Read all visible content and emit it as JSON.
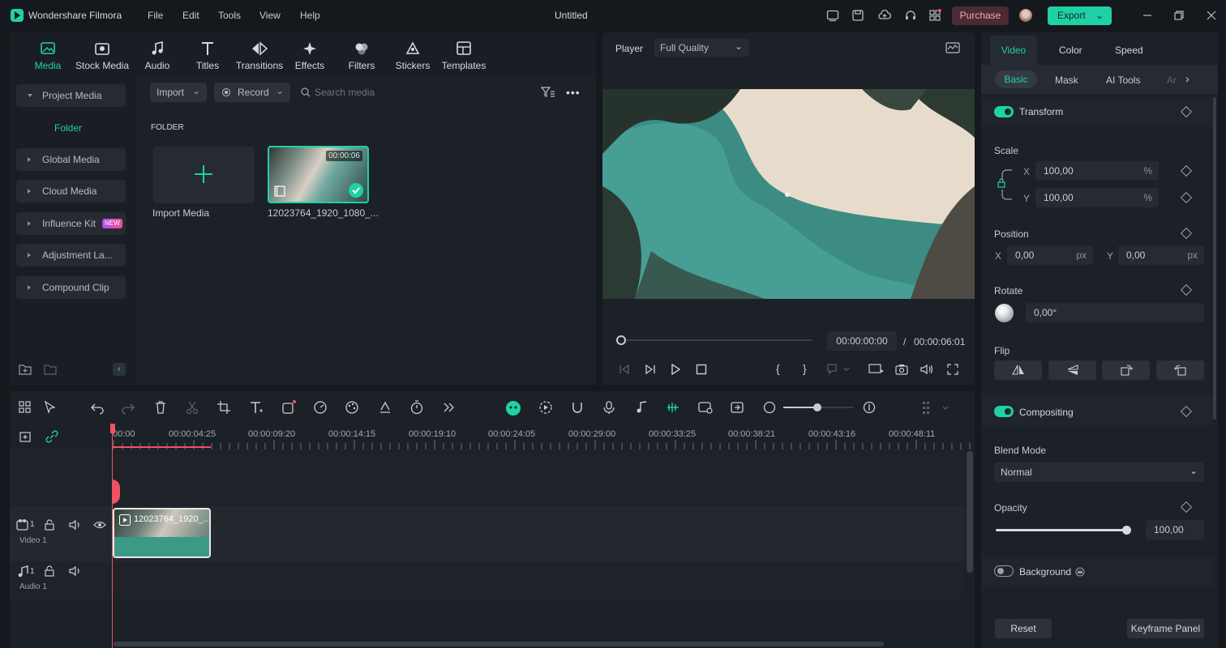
{
  "app": {
    "name": "Wondershare Filmora",
    "doc_title": "Untitled"
  },
  "menu": [
    "File",
    "Edit",
    "Tools",
    "View",
    "Help"
  ],
  "header": {
    "purchase": "Purchase",
    "export": "Export"
  },
  "toolbar_tabs": [
    "Media",
    "Stock Media",
    "Audio",
    "Titles",
    "Transitions",
    "Effects",
    "Filters",
    "Stickers",
    "Templates"
  ],
  "sidebar": {
    "project_media": "Project Media",
    "folder": "Folder",
    "items": [
      "Global Media",
      "Cloud Media",
      "Influence Kit",
      "Adjustment La...",
      "Compound Clip"
    ],
    "new_badge": "NEW"
  },
  "media": {
    "import": "Import",
    "record": "Record",
    "search_placeholder": "Search media",
    "folder_heading": "FOLDER",
    "import_media": "Import Media",
    "clip_name": "12023764_1920_1080_...",
    "clip_duration": "00:00:06"
  },
  "player": {
    "label": "Player",
    "quality": "Full Quality",
    "current_time": "00:00:00:00",
    "separator": "/",
    "total_time": "00:00:06:01"
  },
  "timeline": {
    "ruler": [
      "00:00",
      "00:00:04:25",
      "00:00:09:20",
      "00:00:14:15",
      "00:00:19:10",
      "00:00:24:05",
      "00:00:29:00",
      "00:00:33:25",
      "00:00:38:21",
      "00:00:43:16",
      "00:00:48:11"
    ],
    "video_track": "Video 1",
    "audio_track": "Audio 1",
    "track_num": "1",
    "clip_label": "12023764_1920_..."
  },
  "props": {
    "tabs": [
      "Video",
      "Color",
      "Speed"
    ],
    "subtabs": [
      "Basic",
      "Mask",
      "AI Tools",
      "Ar"
    ],
    "transform": "Transform",
    "scale": "Scale",
    "scale_x": "100,00",
    "scale_y": "100,00",
    "percent": "%",
    "x": "X",
    "y": "Y",
    "position": "Position",
    "pos_x": "0,00",
    "pos_y": "0,00",
    "px": "px",
    "rotate": "Rotate",
    "rotate_val": "0,00°",
    "flip": "Flip",
    "compositing": "Compositing",
    "blend_mode": "Blend Mode",
    "blend_value": "Normal",
    "opacity": "Opacity",
    "opacity_val": "100,00",
    "opacity_level": 1.0,
    "background": "Background",
    "reset": "Reset",
    "keyframe_panel": "Keyframe Panel"
  },
  "colors": {
    "accent": "#1fd1a5",
    "purchase_bg": "#4a2b33",
    "purchase_fg": "#f2a5b5",
    "playhead": "#f0525f"
  }
}
